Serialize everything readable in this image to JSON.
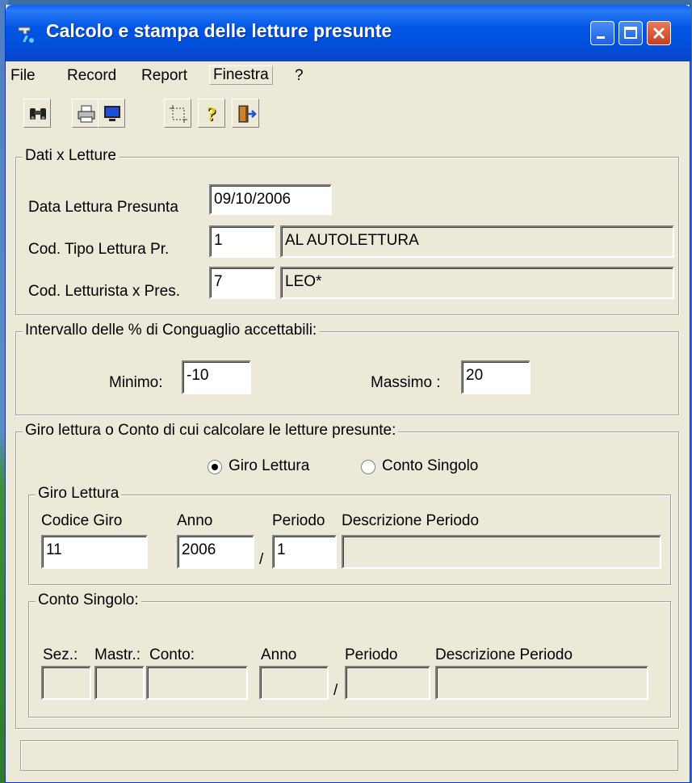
{
  "window": {
    "title": "Calcolo e stampa delle letture presunte",
    "colors": {
      "titlebar": "#0055e5",
      "client": "#ece9d8",
      "close": "#d9542f"
    }
  },
  "menu": [
    "File",
    "Record",
    "Report",
    "Finestra",
    "?"
  ],
  "toolbar": {
    "icons": [
      "binoculars-icon",
      "printer-icon",
      "monitor-icon",
      "select-icon",
      "help-icon",
      "exit-icon"
    ]
  },
  "dati_letture": {
    "group_label": "Dati x Letture",
    "data_label": "Data Lettura Presunta",
    "data_value": "09/10/2006",
    "tipo_label": "Cod. Tipo Lettura Pr.",
    "tipo_code": "1",
    "tipo_desc": "AL AUTOLETTURA",
    "letturista_label": "Cod. Letturista x Pres.",
    "letturista_code": "7",
    "letturista_desc": "LEO*"
  },
  "intervallo": {
    "group_label": "Intervallo delle % di Conguaglio accettabili:",
    "min_label": "Minimo:",
    "min_value": "-10",
    "max_label": "Massimo :",
    "max_value": "20"
  },
  "giro_conto": {
    "group_label": "Giro lettura o Conto di cui calcolare le letture presunte:",
    "radio_giro": "Giro Lettura",
    "radio_conto": "Conto Singolo",
    "selected": "Giro Lettura"
  },
  "giro_lettura": {
    "group_label": "Giro Lettura",
    "codice_label": "Codice Giro",
    "anno_label": "Anno",
    "periodo_label": "Periodo",
    "descr_label": "Descrizione Periodo",
    "codice_value": "11",
    "anno_value": "2006",
    "slash": "/",
    "periodo_value": "1",
    "descr_value": ""
  },
  "conto_singolo": {
    "group_label": "Conto Singolo:",
    "sez_label": "Sez.:",
    "mastr_label": "Mastr.:",
    "conto_label": "Conto:",
    "anno_label": "Anno",
    "periodo_label": "Periodo",
    "descr_label": "Descrizione Periodo",
    "slash": "/"
  },
  "status": {
    "text": ""
  }
}
